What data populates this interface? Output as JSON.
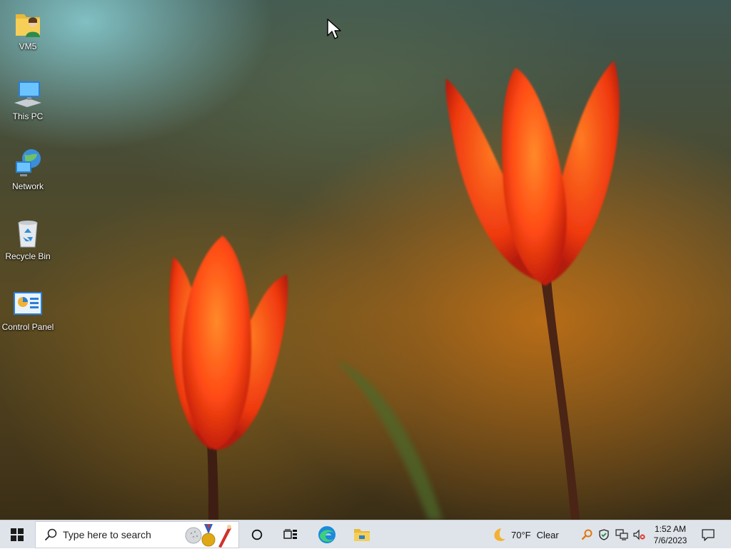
{
  "desktop": {
    "icons": [
      {
        "label": "VM5",
        "icon": "user-folder-icon"
      },
      {
        "label": "This PC",
        "icon": "computer-icon"
      },
      {
        "label": "Network",
        "icon": "network-icon"
      },
      {
        "label": "Recycle Bin",
        "icon": "recycle-bin-icon"
      },
      {
        "label": "Control Panel",
        "icon": "control-panel-icon"
      }
    ]
  },
  "taskbar": {
    "search_placeholder": "Type here to search",
    "pinned": [
      "cortana-icon",
      "task-view-icon",
      "edge-icon",
      "file-explorer-icon"
    ],
    "weather": {
      "temp": "70°F",
      "condition": "Clear"
    },
    "clock": {
      "time": "1:52 AM",
      "date": "7/6/2023"
    }
  },
  "colors": {
    "taskbar_bg": "#dfe4ea",
    "tulip": "#ff4a14"
  }
}
